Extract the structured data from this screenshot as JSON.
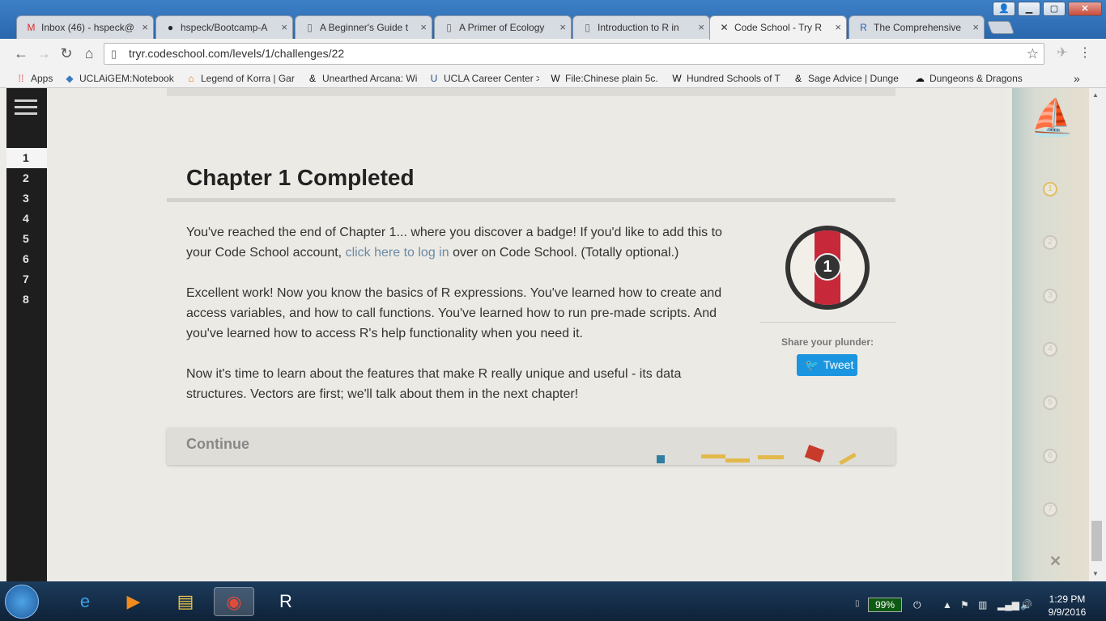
{
  "browser": {
    "tabs": [
      {
        "title": "Inbox (46) - hspeck@",
        "icon": "gmail-icon",
        "glyph": "M",
        "color": "#d93025"
      },
      {
        "title": "hspeck/Bootcamp-A",
        "icon": "github-icon",
        "glyph": "●",
        "color": "#222"
      },
      {
        "title": "A Beginner's Guide t",
        "icon": "page-icon",
        "glyph": "▯",
        "color": "#666"
      },
      {
        "title": "A Primer of Ecology",
        "icon": "page-icon",
        "glyph": "▯",
        "color": "#666"
      },
      {
        "title": "Introduction to R in",
        "icon": "page-icon",
        "glyph": "▯",
        "color": "#666"
      },
      {
        "title": "Code School - Try R",
        "icon": "crossed-swords-icon",
        "glyph": "✕",
        "color": "#333"
      },
      {
        "title": "The Comprehensive",
        "icon": "r-logo-icon",
        "glyph": "R",
        "color": "#2465b3"
      }
    ],
    "tab_close": "×",
    "window_controls": {
      "minimize": "▁",
      "maximize": "▢",
      "close": "✕"
    },
    "url": "tryr.codeschool.com/levels/1/challenges/22",
    "bookmarks": [
      {
        "label": "Apps",
        "icon": "apps-grid-icon",
        "glyph": "⁞⁞",
        "color": "#d33"
      },
      {
        "label": "UCLAiGEM:Notebook",
        "icon": "igem-icon",
        "glyph": "◆",
        "color": "#3a7cc4"
      },
      {
        "label": "Legend of Korra | Gar",
        "icon": "korra-icon",
        "glyph": "⌂",
        "color": "#e07000"
      },
      {
        "label": "Unearthed Arcana: Wi",
        "icon": "dnd-icon",
        "glyph": "&",
        "color": "#111"
      },
      {
        "label": "UCLA Career Center >",
        "icon": "ucla-icon",
        "glyph": "U",
        "color": "#2a4f8a"
      },
      {
        "label": "File:Chinese plain 5c.",
        "icon": "wikipedia-icon",
        "glyph": "W",
        "color": "#111"
      },
      {
        "label": "Hundred Schools of T",
        "icon": "wikipedia-icon",
        "glyph": "W",
        "color": "#111"
      },
      {
        "label": "Sage Advice | Dunge",
        "icon": "dnd-icon",
        "glyph": "&",
        "color": "#111"
      },
      {
        "label": "Dungeons & Dragons",
        "icon": "dragon-icon",
        "glyph": "☁",
        "color": "#111"
      }
    ],
    "bookmarks_overflow": "»"
  },
  "sidebar": {
    "levels": [
      "1",
      "2",
      "3",
      "4",
      "5",
      "6",
      "7",
      "8"
    ],
    "current": "1"
  },
  "main": {
    "title": "Chapter 1 Completed",
    "p1_before": "You've reached the end of Chapter 1... where you discover a badge! If you'd like to add this to your Code School account, ",
    "p1_link": "click here to log in",
    "p1_after": " over on Code School. (Totally optional.)",
    "p2": "Excellent work! Now you know the basics of R expressions. You've learned how to create and access variables, and how to call functions. You've learned how to run pre-made scripts. And you've learned how to access R's help functionality when you need it.",
    "p3": "Now it's time to learn about the features that make R really unique and useful - its data structures. Vectors are first; we'll talk about them in the next chapter!",
    "badge_number": "1",
    "share_label": "Share your plunder:",
    "tweet_label": "Tweet",
    "continue_label": "Continue"
  },
  "map": {
    "checkpoints": [
      "1",
      "2",
      "3",
      "4",
      "5",
      "6",
      "7"
    ],
    "completed": "1"
  },
  "taskbar": {
    "battery": "99%",
    "time": "1:29 PM",
    "date": "9/9/2016",
    "apps": [
      {
        "name": "internet-explorer-icon",
        "glyph": "e",
        "color": "#3aa0e8"
      },
      {
        "name": "media-player-icon",
        "glyph": "▶",
        "color": "#f28b1e"
      },
      {
        "name": "file-explorer-icon",
        "glyph": "▤",
        "color": "#f1c749"
      },
      {
        "name": "chrome-icon",
        "glyph": "◉",
        "color": "#e24a3b"
      },
      {
        "name": "r-gui-icon",
        "glyph": "R",
        "color": "#ffffff"
      }
    ]
  }
}
